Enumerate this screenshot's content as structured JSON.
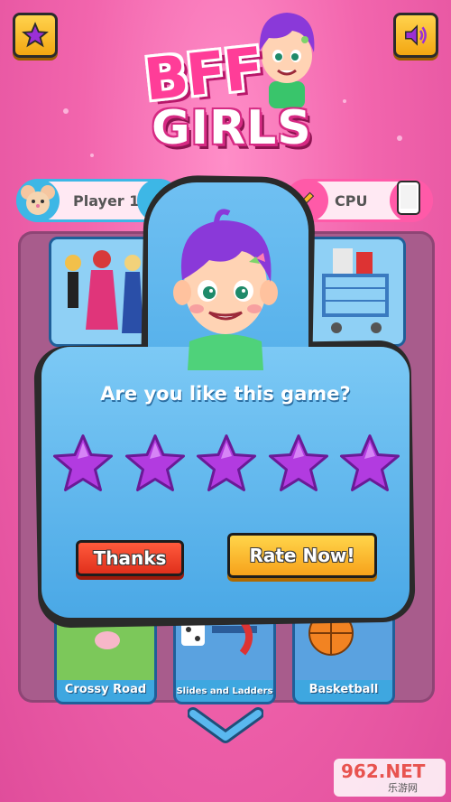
{
  "top_bar": {
    "star_icon": "star-icon",
    "sound_icon": "speaker-icon"
  },
  "logo": {
    "line1": "BFF",
    "line2": "GIRLS"
  },
  "players": {
    "player1_label": "Player 1",
    "cpu_label": "CPU"
  },
  "games": {
    "tiles": [
      {
        "label": "Crossy Road"
      },
      {
        "label": "Slides and Ladders"
      },
      {
        "label": "Basketball"
      }
    ]
  },
  "rating_dialog": {
    "question": "Are you like this game?",
    "star_count": 5,
    "thanks_label": "Thanks",
    "rate_label": "Rate Now!"
  },
  "watermark": {
    "brand": "962.NET",
    "sub": "乐游网"
  },
  "colors": {
    "background": "#f265ad",
    "dialog": "#4aa8e6",
    "star": "#b23be0",
    "thanks": "#e0301c",
    "rate": "#f7a21b"
  }
}
